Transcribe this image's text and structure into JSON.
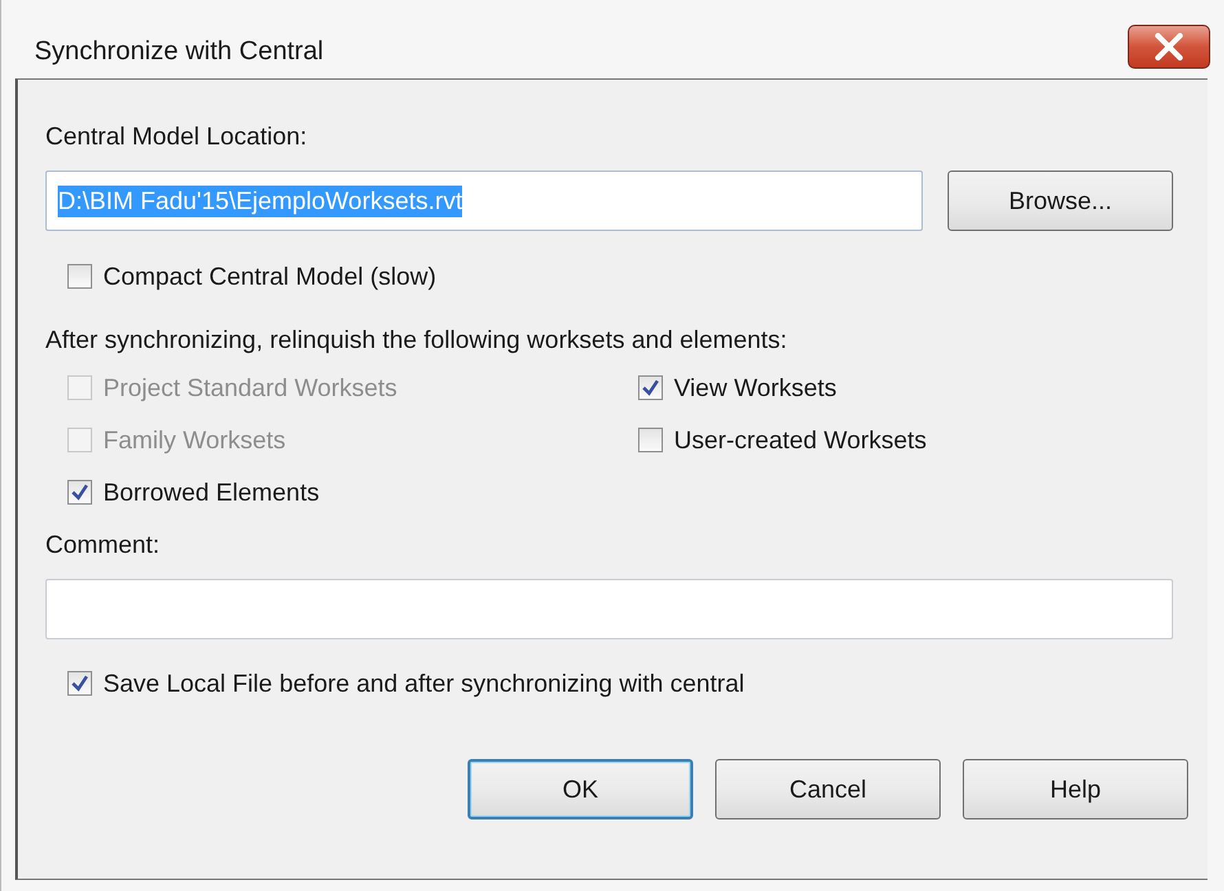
{
  "window": {
    "title": "Synchronize with Central"
  },
  "central_model": {
    "label": "Central Model Location:",
    "value": "D:\\BIM Fadu'15\\EjemploWorksets.rvt",
    "highlighted": true
  },
  "browse_button": {
    "label": "Browse..."
  },
  "compact": {
    "label": "Compact Central Model (slow)",
    "checked": false
  },
  "relinquish": {
    "label": "After synchronizing, relinquish the following worksets and elements:",
    "options": [
      {
        "label": "Project Standard Worksets",
        "checked": false,
        "disabled": true
      },
      {
        "label": "View Worksets",
        "checked": true,
        "disabled": false
      },
      {
        "label": "Family Worksets",
        "checked": false,
        "disabled": true
      },
      {
        "label": "User-created Worksets",
        "checked": false,
        "disabled": false
      },
      {
        "label": "Borrowed Elements",
        "checked": true,
        "disabled": false
      }
    ]
  },
  "comment": {
    "label": "Comment:"
  },
  "save_local": {
    "label": "Save Local File before and after synchronizing with central",
    "checked": true
  },
  "buttons": [
    {
      "label": "OK",
      "default": true
    },
    {
      "label": "Cancel",
      "default": false
    },
    {
      "label": "Help",
      "default": false
    }
  ]
}
